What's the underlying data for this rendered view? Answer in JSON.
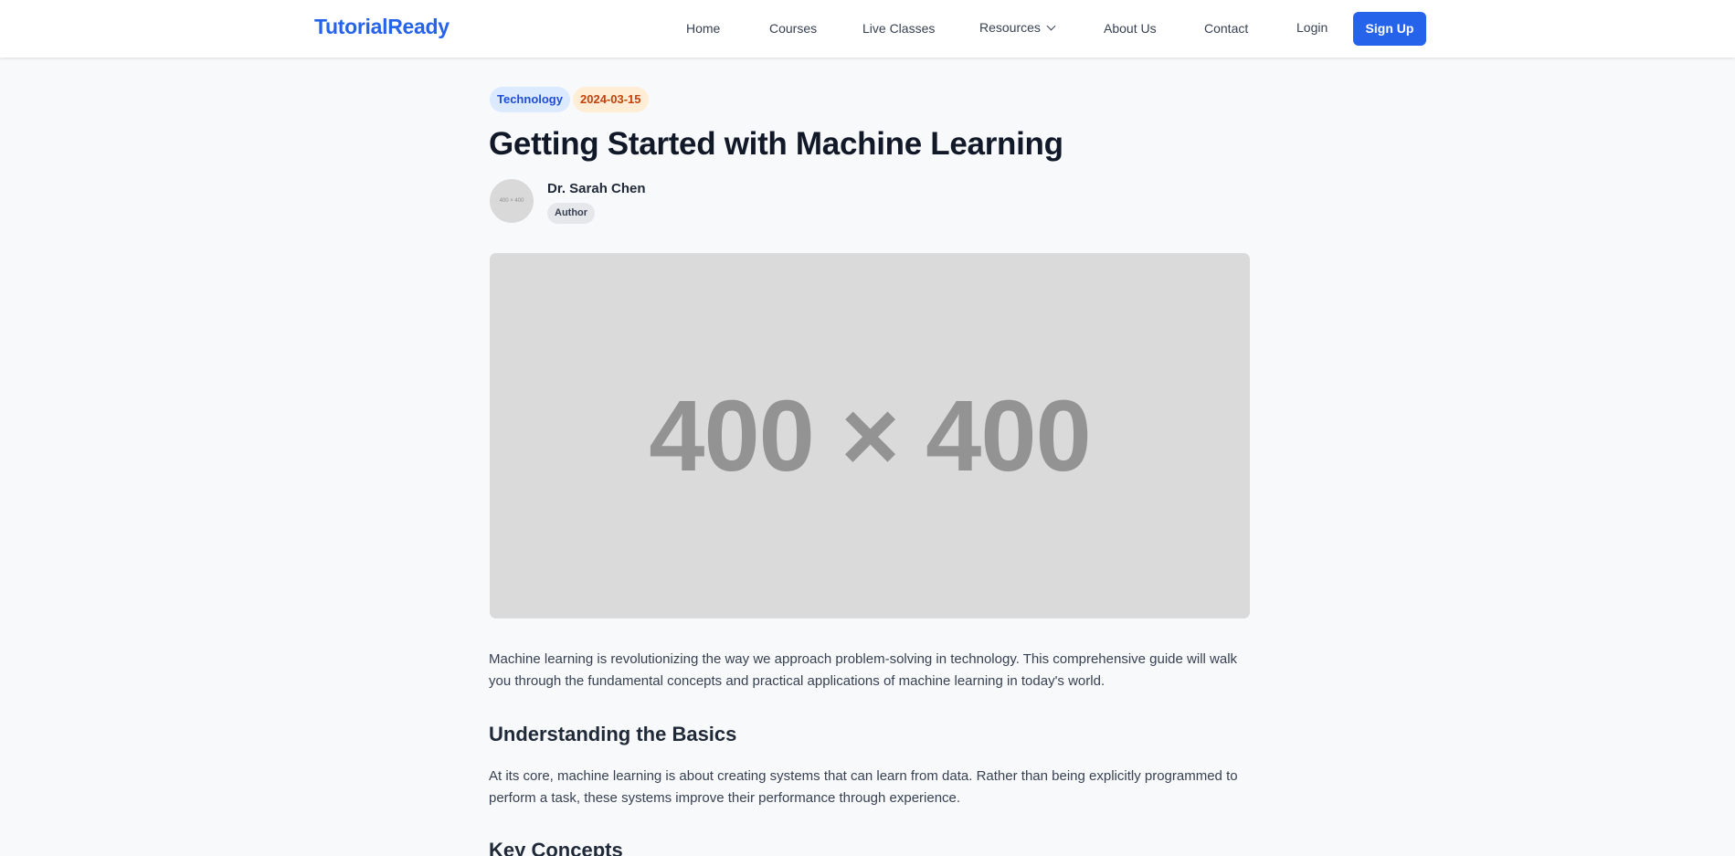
{
  "nav": {
    "logo": "TutorialReady",
    "links": [
      "Home",
      "Courses",
      "Live Classes",
      "Resources",
      "About Us",
      "Contact"
    ],
    "login": "Login",
    "signup": "Sign Up"
  },
  "article": {
    "category": "Technology",
    "date": "2024-03-15",
    "title": "Getting Started with Machine Learning",
    "author": {
      "avatar_placeholder": "400 × 400",
      "name": "Dr. Sarah Chen",
      "role": "Author"
    },
    "hero_placeholder": "400 × 400",
    "intro": "Machine learning is revolutionizing the way we approach problem-solving in technology. This comprehensive guide will walk you through the fundamental concepts and practical applications of machine learning in today's world.",
    "section1_heading": "Understanding the Basics",
    "section1_text": "At its core, machine learning is about creating systems that can learn from data. Rather than being explicitly programmed to perform a task, these systems improve their performance through experience.",
    "section2_heading": "Key Concepts"
  }
}
